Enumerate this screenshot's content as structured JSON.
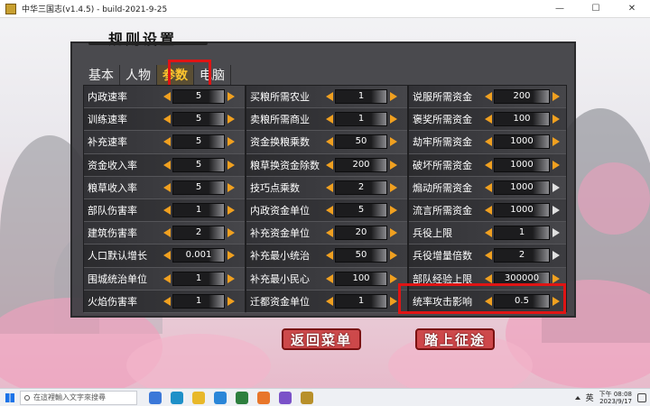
{
  "window": {
    "title": "中华三国志(v1.4.5) - build-2021-9-25",
    "minimize": "—",
    "maximize": "☐",
    "close": "✕"
  },
  "panel": {
    "title": "规则设置"
  },
  "tabs": [
    {
      "label": "基本",
      "active": false
    },
    {
      "label": "人物",
      "active": false
    },
    {
      "label": "参数",
      "active": true
    },
    {
      "label": "电脑",
      "active": false
    }
  ],
  "params": {
    "col1": [
      {
        "label": "内政速率",
        "value": "5"
      },
      {
        "label": "训练速率",
        "value": "5"
      },
      {
        "label": "补充速率",
        "value": "5"
      },
      {
        "label": "资金收入率",
        "value": "5"
      },
      {
        "label": "粮草收入率",
        "value": "5"
      },
      {
        "label": "部队伤害率",
        "value": "1"
      },
      {
        "label": "建筑伤害率",
        "value": "2"
      },
      {
        "label": "人口默认增长",
        "value": "0.001"
      },
      {
        "label": "围城统治单位",
        "value": "1"
      },
      {
        "label": "火焰伤害率",
        "value": "1"
      }
    ],
    "col2": [
      {
        "label": "买粮所需农业",
        "value": "1"
      },
      {
        "label": "卖粮所需商业",
        "value": "1"
      },
      {
        "label": "资金换粮乘数",
        "value": "50"
      },
      {
        "label": "粮草换资金除数",
        "value": "200"
      },
      {
        "label": "技巧点乘数",
        "value": "2"
      },
      {
        "label": "内政资金单位",
        "value": "5"
      },
      {
        "label": "补充资金单位",
        "value": "20"
      },
      {
        "label": "补充最小统治",
        "value": "50"
      },
      {
        "label": "补充最小民心",
        "value": "100"
      },
      {
        "label": "迁都资金单位",
        "value": "1"
      }
    ],
    "col3": [
      {
        "label": "说服所需资金",
        "value": "200"
      },
      {
        "label": "褒奖所需资金",
        "value": "100"
      },
      {
        "label": "劫牢所需资金",
        "value": "1000"
      },
      {
        "label": "破坏所需资金",
        "value": "1000"
      },
      {
        "label": "煽动所需资金",
        "value": "1000"
      },
      {
        "label": "流言所需资金",
        "value": "1000"
      },
      {
        "label": "兵役上限",
        "value": "1"
      },
      {
        "label": "兵役增量倍数",
        "value": "2"
      },
      {
        "label": "部队经验上限",
        "value": "300000"
      },
      {
        "label": "统率攻击影响",
        "value": "0.5"
      }
    ]
  },
  "buttons": {
    "back": "返回菜单",
    "start": "踏上征途"
  },
  "taskbar": {
    "search_placeholder": "在這裡輸入文字來搜尋",
    "lang": "英",
    "time": "下午 08:08",
    "date": "2023/9/17"
  },
  "colors": {
    "accent_arrow": "#f0a020",
    "active_tab": "#ffc52e",
    "highlight": "#e01414"
  }
}
